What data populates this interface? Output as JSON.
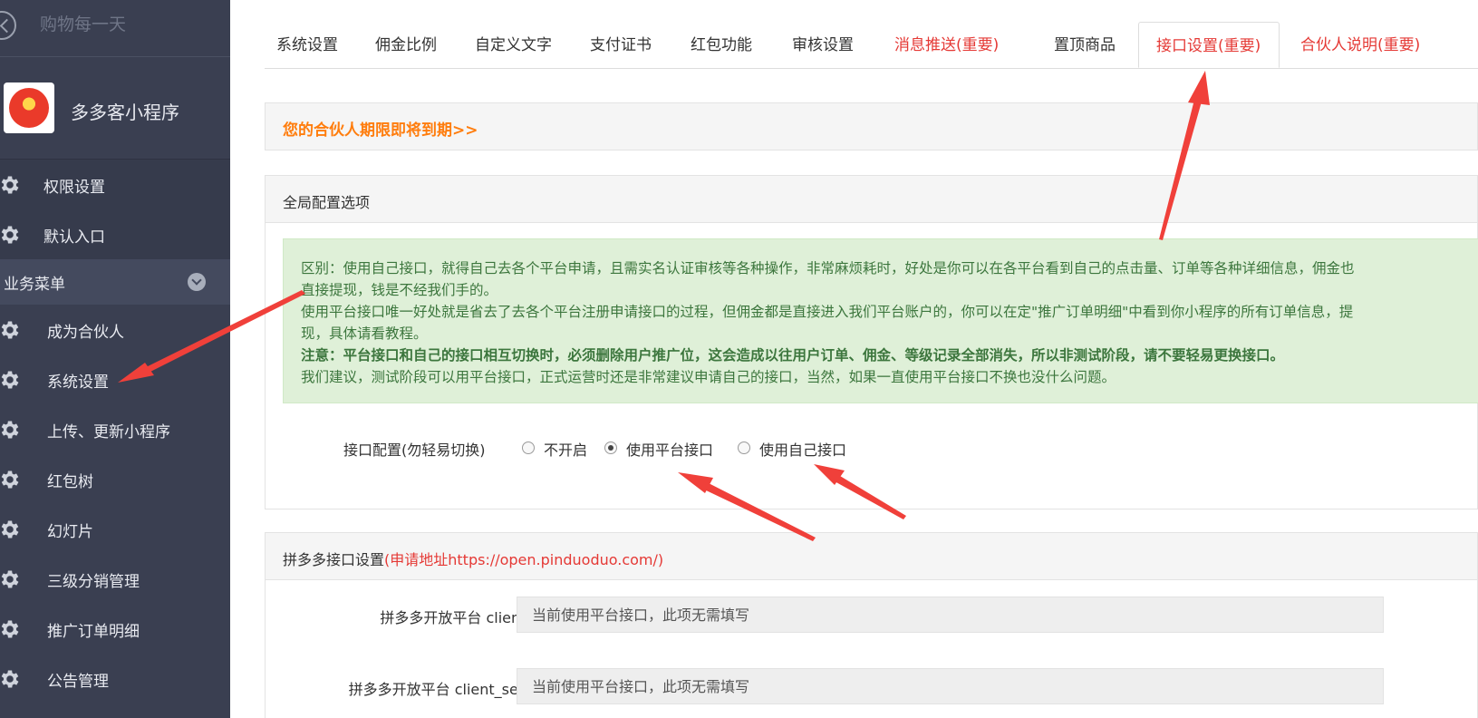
{
  "sidebar": {
    "top_title": "购物每一天",
    "app_name": "多多客小程序",
    "items_top": [
      {
        "label": "权限设置"
      },
      {
        "label": "默认入口"
      }
    ],
    "group_label": "业务菜单",
    "items_sub": [
      {
        "label": "成为合伙人"
      },
      {
        "label": "系统设置"
      },
      {
        "label": "上传、更新小程序"
      },
      {
        "label": "红包树"
      },
      {
        "label": "幻灯片"
      },
      {
        "label": "三级分销管理"
      },
      {
        "label": "推广订单明细"
      },
      {
        "label": "公告管理"
      }
    ]
  },
  "tabs": [
    {
      "label": "系统设置"
    },
    {
      "label": "佣金比例"
    },
    {
      "label": "自定义文字"
    },
    {
      "label": "支付证书"
    },
    {
      "label": "红包功能"
    },
    {
      "label": "审核设置"
    },
    {
      "label": "消息推送(重要)"
    },
    {
      "label": "置顶商品"
    },
    {
      "label": "接口设置(重要)"
    },
    {
      "label": "合伙人说明(重要)"
    }
  ],
  "notice": "您的合伙人期限即将到期>>",
  "global_panel": {
    "title": "全局配置选项",
    "info_lines": [
      "区别：使用自己接口，就得自己去各个平台申请，且需实名认证审核等各种操作，非常麻烦耗时，好处是你可以在各平台看到自己的点击量、订单等各种详细信息，佣金也",
      "直接提现，钱是不经我们手的。",
      "使用平台接口唯一好处就是省去了去各个平台注册申请接口的过程，但佣金都是直接进入我们平台账户的，你可以在定\"推广订单明细\"中看到你小程序的所有订单信息，提",
      "现，具体请看教程。",
      "注意：平台接口和自己的接口相互切换时，必须删除用户推广位，这会造成以往用户订单、佣金、等级记录全部消失，所以非测试阶段，请不要轻易更换接口。",
      "我们建议，测试阶段可以用平台接口，正式运营时还是非常建议申请自己的接口，当然，如果一直使用平台接口不换也没什么问题。"
    ],
    "radio_label": "接口配置(勿轻易切换)",
    "radio_options": [
      {
        "label": "不开启",
        "checked": false
      },
      {
        "label": "使用平台接口",
        "checked": true
      },
      {
        "label": "使用自己接口",
        "checked": false
      }
    ]
  },
  "pdd_panel": {
    "title": "拼多多接口设置",
    "title_link": "(申请地址https://open.pinduoduo.com/)",
    "fields": [
      {
        "label": "拼多多开放平台 client_id",
        "placeholder": "当前使用平台接口，此项无需填写"
      },
      {
        "label": "拼多多开放平台 client_secret",
        "placeholder": "当前使用平台接口，此项无需填写"
      }
    ]
  },
  "colors": {
    "sidebar_bg": "#3a3f51",
    "accent_red": "#e53935",
    "notice_orange": "#ff7d0d",
    "info_green_bg": "#dff0d8",
    "info_green_text": "#3c763d",
    "annotation_arrow": "#f0403a"
  }
}
